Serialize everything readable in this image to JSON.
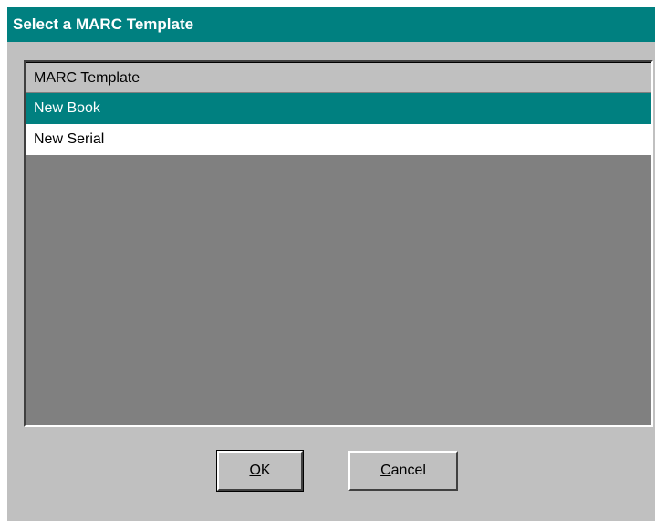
{
  "window": {
    "title": "Select a MARC Template"
  },
  "list": {
    "header": "MARC Template",
    "items": [
      {
        "label": "New Book",
        "selected": true
      },
      {
        "label": "New Serial",
        "selected": false
      }
    ]
  },
  "buttons": {
    "ok": {
      "mnemonic": "O",
      "rest": "K"
    },
    "cancel": {
      "mnemonic": "C",
      "rest": "ancel"
    }
  },
  "colors": {
    "title_bar": "#008080",
    "selection": "#008080",
    "face": "#c0c0c0",
    "list_background": "#808080"
  }
}
